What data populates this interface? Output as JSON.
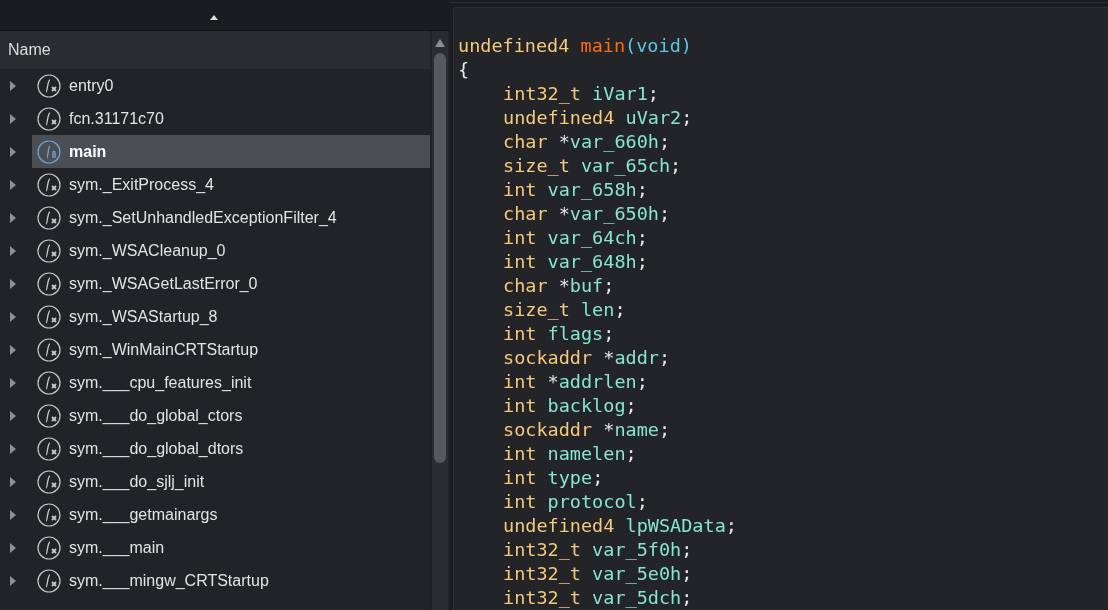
{
  "function_list": {
    "column_header": "Name",
    "items": [
      {
        "name": "entry0",
        "kind": "function",
        "selected": false
      },
      {
        "name": "fcn.31171c70",
        "kind": "function",
        "selected": false
      },
      {
        "name": "main",
        "kind": "entry",
        "selected": true
      },
      {
        "name": "sym._ExitProcess_4",
        "kind": "function",
        "selected": false
      },
      {
        "name": "sym._SetUnhandledExceptionFilter_4",
        "kind": "function",
        "selected": false
      },
      {
        "name": "sym._WSACleanup_0",
        "kind": "function",
        "selected": false
      },
      {
        "name": "sym._WSAGetLastError_0",
        "kind": "function",
        "selected": false
      },
      {
        "name": "sym._WSAStartup_8",
        "kind": "function",
        "selected": false
      },
      {
        "name": "sym._WinMainCRTStartup",
        "kind": "function",
        "selected": false
      },
      {
        "name": "sym.___cpu_features_init",
        "kind": "function",
        "selected": false
      },
      {
        "name": "sym.___do_global_ctors",
        "kind": "function",
        "selected": false
      },
      {
        "name": "sym.___do_global_dtors",
        "kind": "function",
        "selected": false
      },
      {
        "name": "sym.___do_sjlj_init",
        "kind": "function",
        "selected": false
      },
      {
        "name": "sym.___getmainargs",
        "kind": "function",
        "selected": false
      },
      {
        "name": "sym.___main",
        "kind": "function",
        "selected": false
      },
      {
        "name": "sym.___mingw_CRTStartup",
        "kind": "function",
        "selected": false
      }
    ]
  },
  "decompiler": {
    "signature": [
      {
        "text": "undefined4 ",
        "kind": "type"
      },
      {
        "text": "main",
        "kind": "func"
      },
      {
        "text": "(void)",
        "kind": "param"
      }
    ],
    "open_brace": "{",
    "declarations": [
      [
        {
          "text": "int32_t ",
          "kind": "type"
        },
        {
          "text": "iVar1",
          "kind": "var"
        },
        {
          "text": ";",
          "kind": "punct"
        }
      ],
      [
        {
          "text": "undefined4 ",
          "kind": "type"
        },
        {
          "text": "uVar2",
          "kind": "var"
        },
        {
          "text": ";",
          "kind": "punct"
        }
      ],
      [
        {
          "text": "char ",
          "kind": "type"
        },
        {
          "text": "*",
          "kind": "punct"
        },
        {
          "text": "var_660h",
          "kind": "var"
        },
        {
          "text": ";",
          "kind": "punct"
        }
      ],
      [
        {
          "text": "size_t ",
          "kind": "type"
        },
        {
          "text": "var_65ch",
          "kind": "var"
        },
        {
          "text": ";",
          "kind": "punct"
        }
      ],
      [
        {
          "text": "int ",
          "kind": "type"
        },
        {
          "text": "var_658h",
          "kind": "var"
        },
        {
          "text": ";",
          "kind": "punct"
        }
      ],
      [
        {
          "text": "char ",
          "kind": "type"
        },
        {
          "text": "*",
          "kind": "punct"
        },
        {
          "text": "var_650h",
          "kind": "var"
        },
        {
          "text": ";",
          "kind": "punct"
        }
      ],
      [
        {
          "text": "int ",
          "kind": "type"
        },
        {
          "text": "var_64ch",
          "kind": "var"
        },
        {
          "text": ";",
          "kind": "punct"
        }
      ],
      [
        {
          "text": "int ",
          "kind": "type"
        },
        {
          "text": "var_648h",
          "kind": "var"
        },
        {
          "text": ";",
          "kind": "punct"
        }
      ],
      [
        {
          "text": "char ",
          "kind": "type"
        },
        {
          "text": "*",
          "kind": "punct"
        },
        {
          "text": "buf",
          "kind": "var"
        },
        {
          "text": ";",
          "kind": "punct"
        }
      ],
      [
        {
          "text": "size_t ",
          "kind": "type"
        },
        {
          "text": "len",
          "kind": "var"
        },
        {
          "text": ";",
          "kind": "punct"
        }
      ],
      [
        {
          "text": "int ",
          "kind": "type"
        },
        {
          "text": "flags",
          "kind": "var"
        },
        {
          "text": ";",
          "kind": "punct"
        }
      ],
      [
        {
          "text": "sockaddr ",
          "kind": "type"
        },
        {
          "text": "*",
          "kind": "punct"
        },
        {
          "text": "addr",
          "kind": "var"
        },
        {
          "text": ";",
          "kind": "punct"
        }
      ],
      [
        {
          "text": "int ",
          "kind": "type"
        },
        {
          "text": "*",
          "kind": "punct"
        },
        {
          "text": "addrlen",
          "kind": "var"
        },
        {
          "text": ";",
          "kind": "punct"
        }
      ],
      [
        {
          "text": "int ",
          "kind": "type"
        },
        {
          "text": "backlog",
          "kind": "var"
        },
        {
          "text": ";",
          "kind": "punct"
        }
      ],
      [
        {
          "text": "sockaddr ",
          "kind": "type"
        },
        {
          "text": "*",
          "kind": "punct"
        },
        {
          "text": "name",
          "kind": "var"
        },
        {
          "text": ";",
          "kind": "punct"
        }
      ],
      [
        {
          "text": "int ",
          "kind": "type"
        },
        {
          "text": "namelen",
          "kind": "var"
        },
        {
          "text": ";",
          "kind": "punct"
        }
      ],
      [
        {
          "text": "int ",
          "kind": "type"
        },
        {
          "text": "type",
          "kind": "var"
        },
        {
          "text": ";",
          "kind": "punct"
        }
      ],
      [
        {
          "text": "int ",
          "kind": "type"
        },
        {
          "text": "protocol",
          "kind": "var"
        },
        {
          "text": ";",
          "kind": "punct"
        }
      ],
      [
        {
          "text": "undefined4 ",
          "kind": "type"
        },
        {
          "text": "lpWSAData",
          "kind": "var"
        },
        {
          "text": ";",
          "kind": "punct"
        }
      ],
      [
        {
          "text": "int32_t ",
          "kind": "type"
        },
        {
          "text": "var_5f0h",
          "kind": "var"
        },
        {
          "text": ";",
          "kind": "punct"
        }
      ],
      [
        {
          "text": "int32_t ",
          "kind": "type"
        },
        {
          "text": "var_5e0h",
          "kind": "var"
        },
        {
          "text": ";",
          "kind": "punct"
        }
      ],
      [
        {
          "text": "int32_t ",
          "kind": "type"
        },
        {
          "text": "var_5dch",
          "kind": "var"
        },
        {
          "text": ";",
          "kind": "punct"
        }
      ]
    ]
  }
}
